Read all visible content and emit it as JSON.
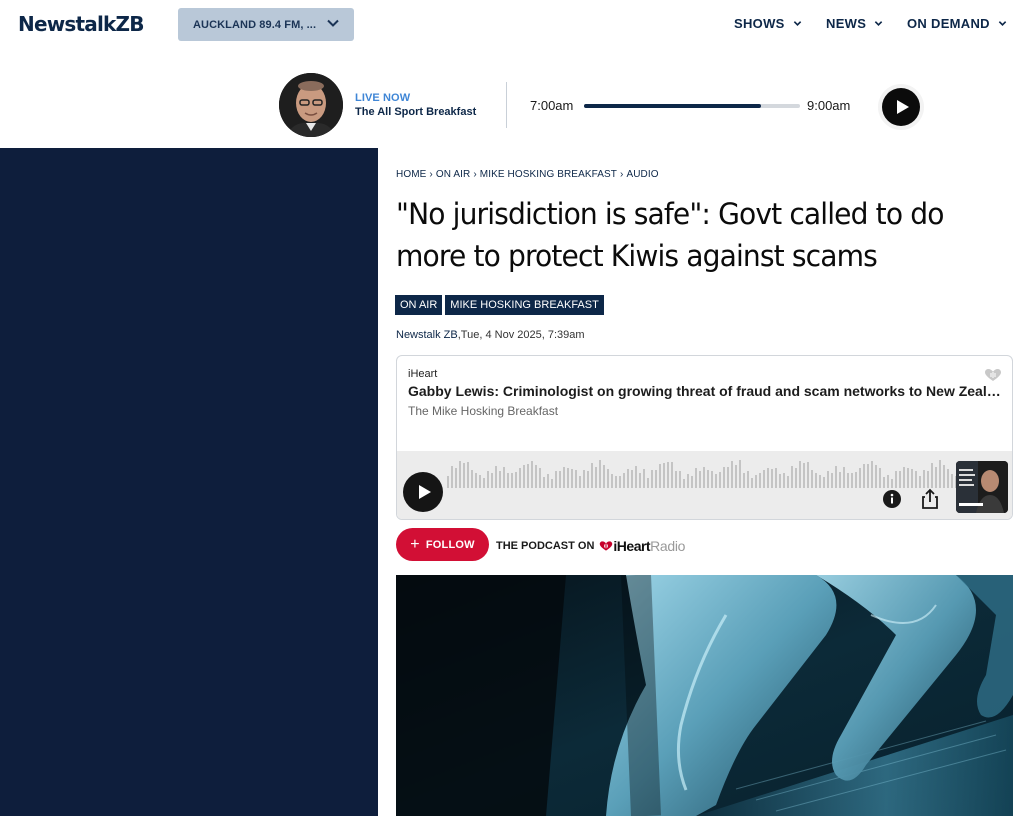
{
  "header": {
    "logo_main": "Newstalk",
    "logo_suffix": "ZB",
    "station_selector": "AUCKLAND 89.4 FM, ...",
    "nav": [
      {
        "label": "SHOWS"
      },
      {
        "label": "NEWS"
      },
      {
        "label": "ON DEMAND"
      }
    ]
  },
  "live": {
    "label": "LIVE NOW",
    "show": "The All Sport Breakfast",
    "start_time": "7:00am",
    "end_time": "9:00am",
    "progress": 0.82
  },
  "article": {
    "breadcrumb": [
      "HOME",
      "ON AIR",
      "MIKE HOSKING BREAKFAST",
      "AUDIO"
    ],
    "breadcrumb_separator": "›",
    "headline": "\"No jurisdiction is safe\": Govt called to do more to protect Kiwis against scams",
    "tags": [
      "ON AIR",
      "MIKE HOSKING BREAKFAST"
    ],
    "byline_source": "Newstalk ZB",
    "byline_date": ",Tue, 4 Nov 2025, 7:39am"
  },
  "player": {
    "provider": "iHeart",
    "title": "Gabby Lewis: Criminologist on growing threat of fraud and scam networks to New Zealand",
    "show": "The Mike Hosking Breakfast",
    "icons": [
      "play-icon",
      "info-icon",
      "share-icon",
      "iheart-logo-icon"
    ]
  },
  "follow": {
    "button_label": "FOLLOW",
    "podcast_on": "THE PODCAST ON",
    "brand_main": "iHeart",
    "brand_suffix": "Radio"
  },
  "colors": {
    "navy": "#0d2748",
    "side_panel": "#0e1e3c",
    "live_blue": "#3f86d6",
    "follow_red": "#d20f35",
    "station_bg": "#b9c8d8"
  }
}
